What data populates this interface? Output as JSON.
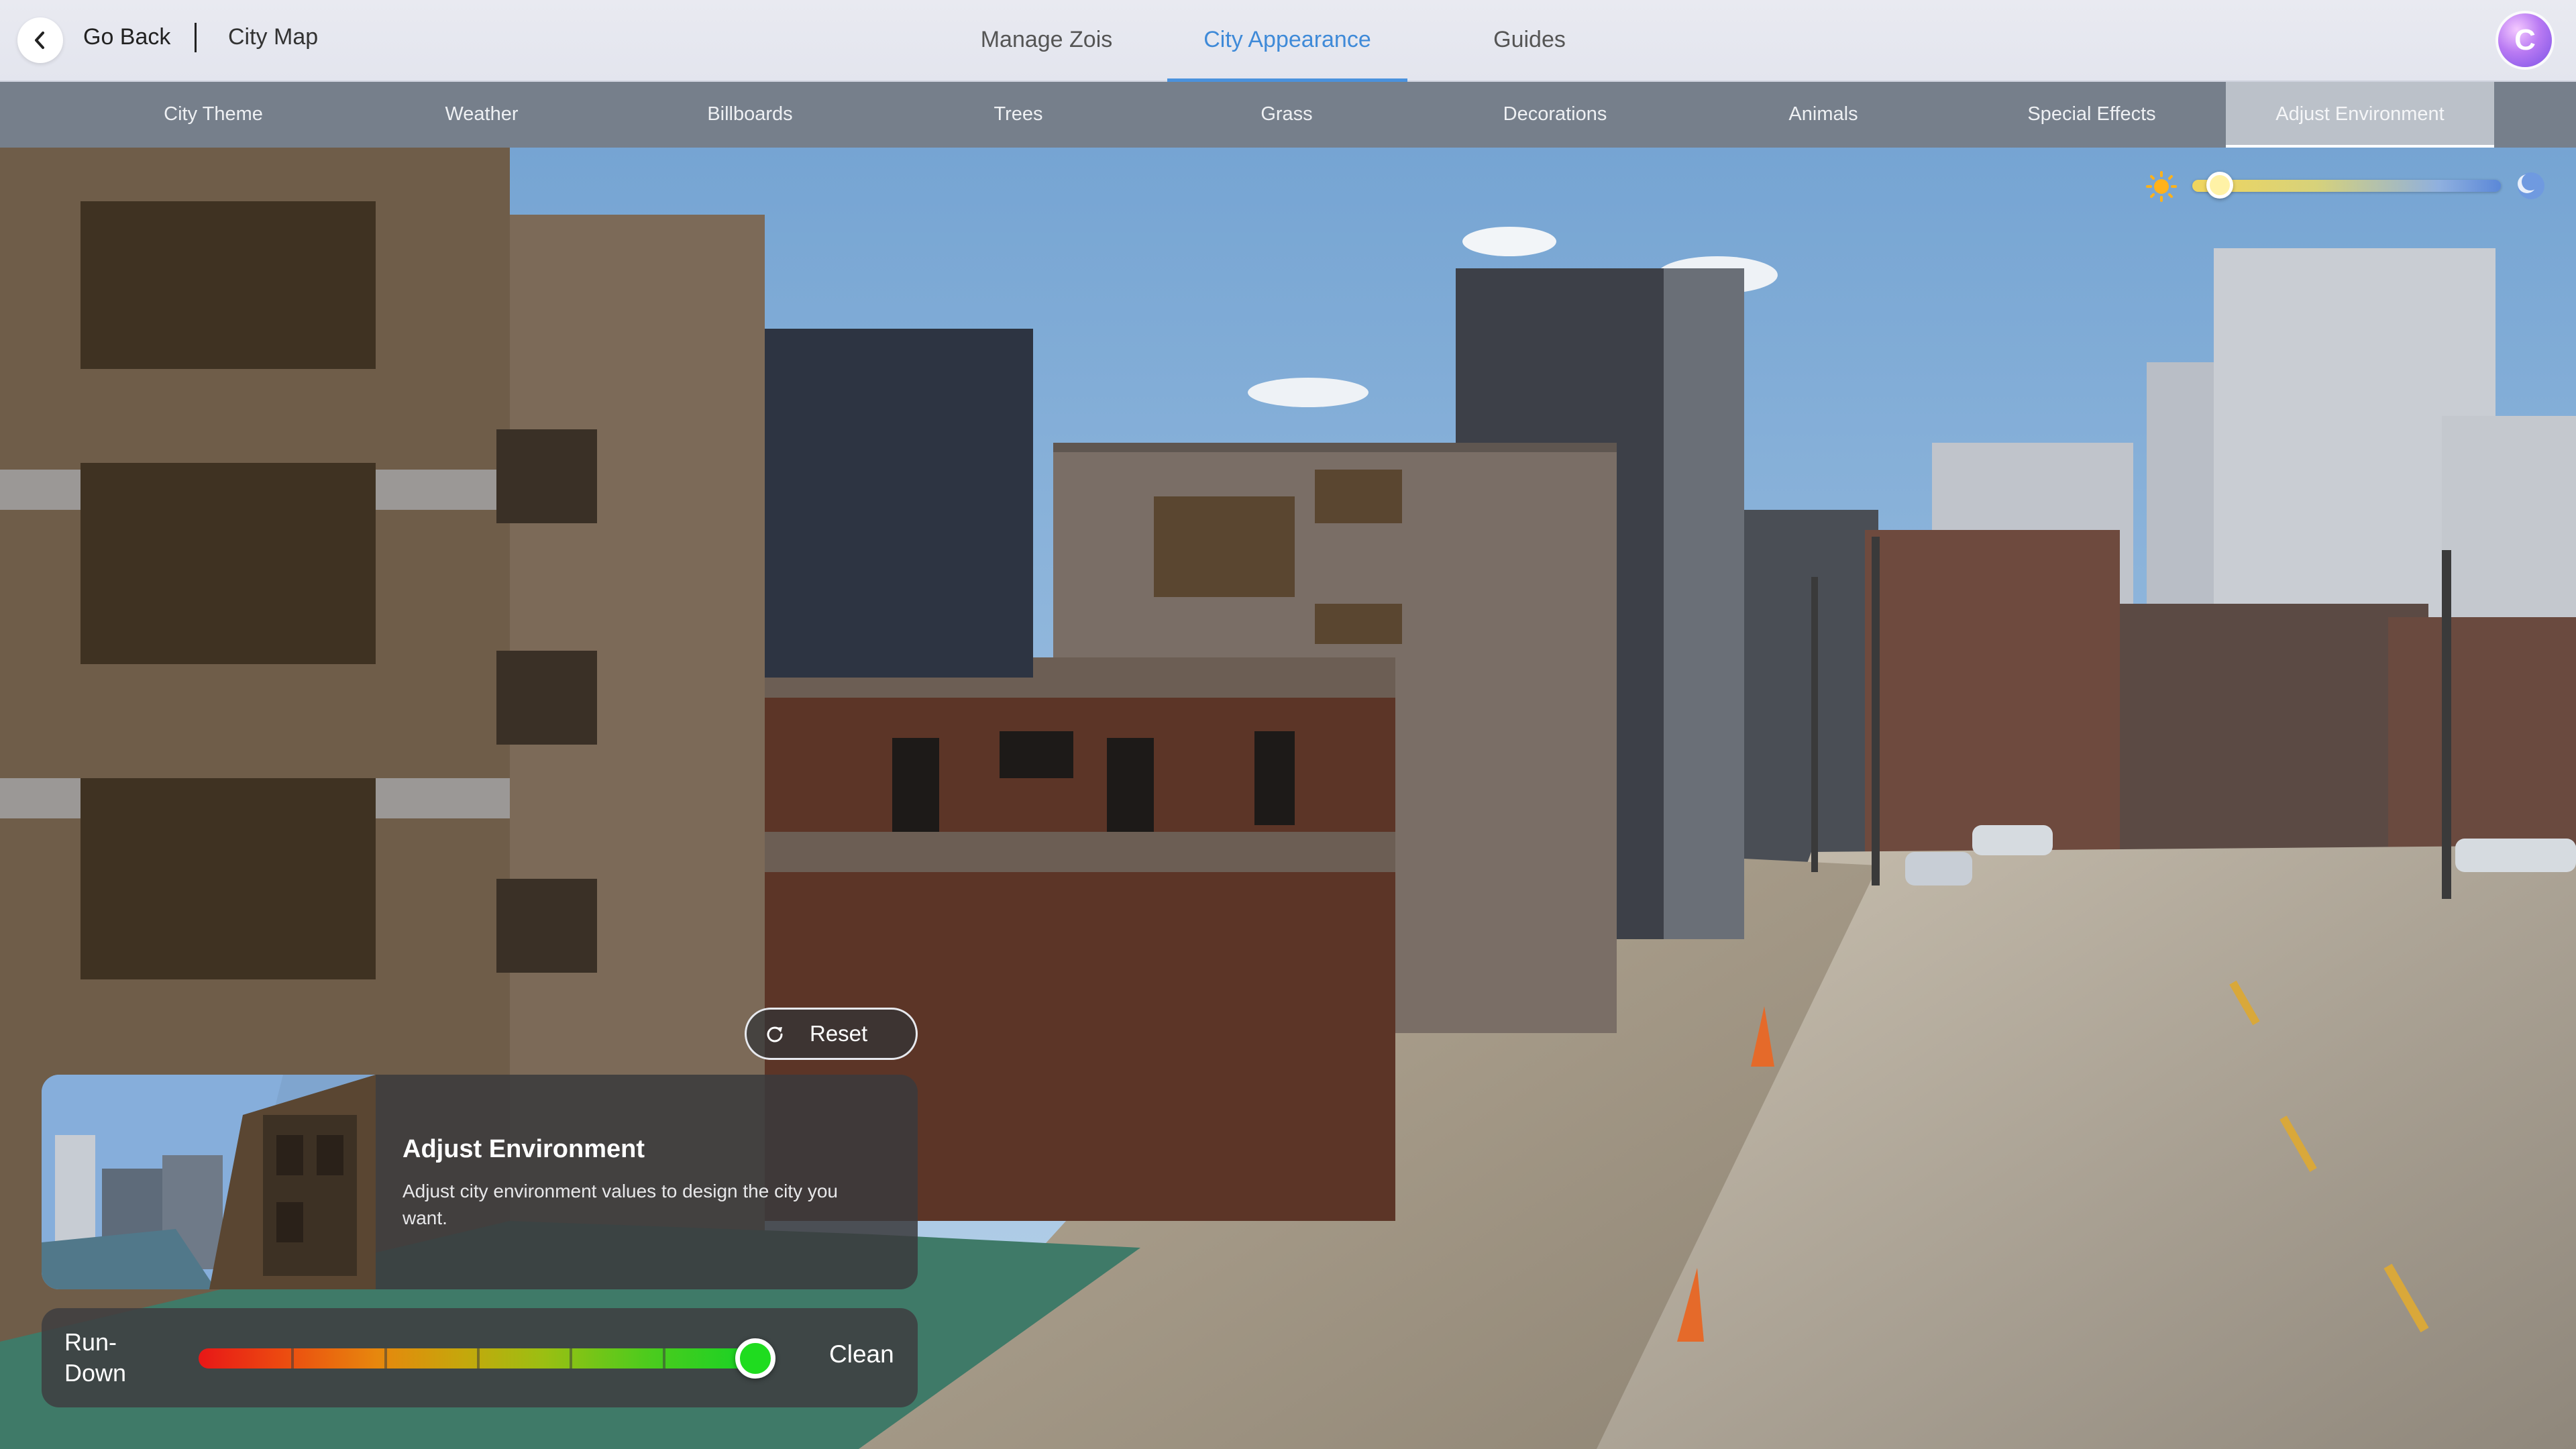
{
  "header": {
    "back_label": "Go Back",
    "breadcrumb_current": "City Map",
    "tabs": [
      {
        "label": "Manage Zois",
        "active": false
      },
      {
        "label": "City Appearance",
        "active": true
      },
      {
        "label": "Guides",
        "active": false
      }
    ],
    "profile_initial": "C"
  },
  "subnav": {
    "tabs": [
      {
        "label": "City Theme",
        "active": false
      },
      {
        "label": "Weather",
        "active": false
      },
      {
        "label": "Billboards",
        "active": false
      },
      {
        "label": "Trees",
        "active": false
      },
      {
        "label": "Grass",
        "active": false
      },
      {
        "label": "Decorations",
        "active": false
      },
      {
        "label": "Animals",
        "active": false
      },
      {
        "label": "Special Effects",
        "active": false
      },
      {
        "label": "Adjust Environment",
        "active": true
      }
    ]
  },
  "time_of_day": {
    "start_icon": "sun-icon",
    "end_icon": "moon-icon",
    "value": 0.09
  },
  "reset": {
    "icon": "refresh-icon",
    "label": "Reset"
  },
  "info_card": {
    "title": "Adjust Environment",
    "description": "Adjust city environment values to design the city you want."
  },
  "condition_slider": {
    "min_label": "Run-\nDown",
    "max_label": "Clean",
    "value": 1.0
  },
  "colors": {
    "accent": "#3f8ad8",
    "condition_low": "#e81717",
    "condition_high": "#15d325"
  }
}
